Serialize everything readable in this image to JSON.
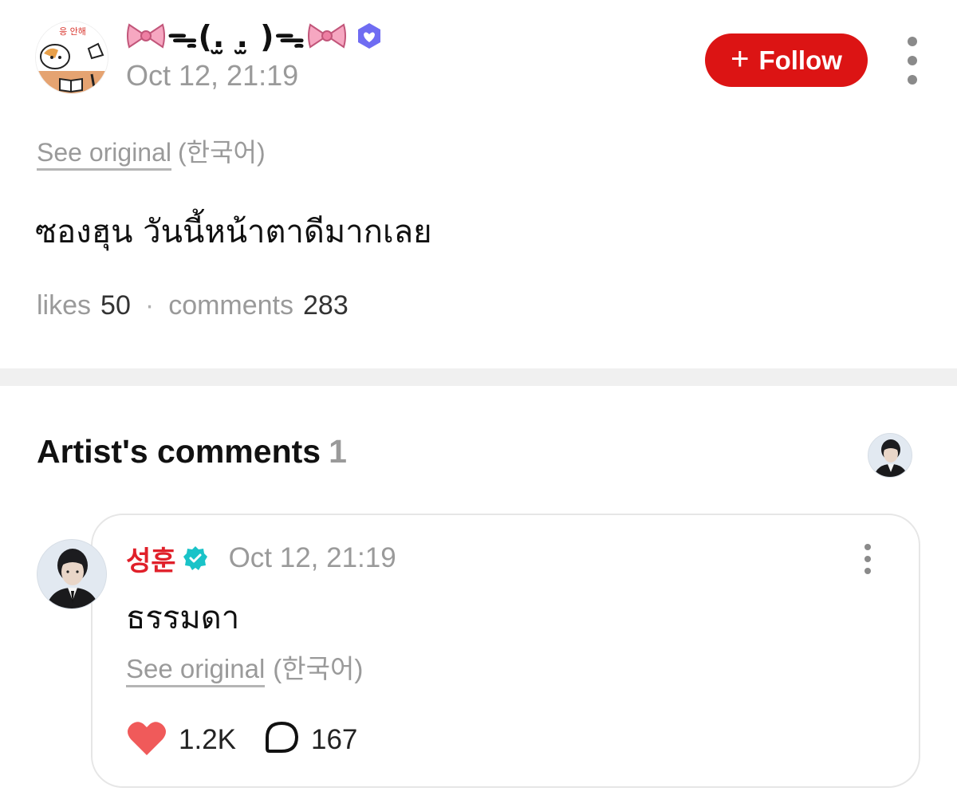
{
  "post": {
    "author_name": "ᯓ(.̫ .̫ )ᯓ",
    "author_avatar_text": "응 안해",
    "timestamp": "Oct 12, 21:19",
    "follow_label": "Follow",
    "see_original_label": "See original",
    "original_language": "(한국어)",
    "text": "ซองฮุน วันนี้หน้าตาดีมากเลย",
    "likes_label": "likes",
    "likes_count": "50",
    "comments_label": "comments",
    "comments_count": "283"
  },
  "artist_comments": {
    "title": "Artist's comments",
    "count": "1",
    "comment": {
      "author": "성훈",
      "timestamp": "Oct 12, 21:19",
      "text": "ธรรมดา",
      "see_original_label": "See original",
      "original_language": "(한국어)",
      "likes": "1.2K",
      "replies": "167"
    }
  },
  "colors": {
    "follow_button": "#dc1414",
    "artist_name": "#e0202a",
    "like_heart": "#f05a5a",
    "verified_badge": "#19c3c8",
    "weverse_badge": "#6f6cf2"
  },
  "icons": [
    "bow-icon",
    "weverse-verified-icon",
    "plus-icon",
    "more-vertical-icon",
    "artist-verified-icon",
    "heart-icon",
    "comment-bubble-icon"
  ]
}
